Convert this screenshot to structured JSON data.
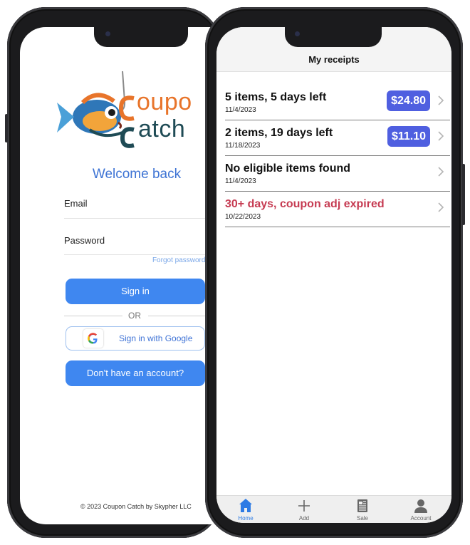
{
  "login": {
    "logo_line1": "oupo",
    "logo_line2": "atch",
    "welcome": "Welcome back",
    "email_label": "Email",
    "password_label": "Password",
    "forgot_password": "Forgot password?",
    "sign_in": "Sign in",
    "or": "OR",
    "google_sign_in": "Sign in with Google",
    "no_account": "Don't have an account?",
    "footer": "© 2023 Coupon Catch by Skypher LLC"
  },
  "receipts": {
    "title": "My receipts",
    "items": [
      {
        "title": "5 items, 5 days left",
        "date": "11/4/2023",
        "price": "$24.80",
        "expired": false
      },
      {
        "title": "2 items, 19 days left",
        "date": "11/18/2023",
        "price": "$11.10",
        "expired": false
      },
      {
        "title": "No eligible items found",
        "date": "11/4/2023",
        "price": null,
        "expired": false
      },
      {
        "title": "30+ days, coupon adj expired",
        "date": "10/22/2023",
        "price": null,
        "expired": true
      }
    ],
    "tabs": [
      {
        "label": "Home",
        "icon": "home-icon",
        "active": true
      },
      {
        "label": "Add",
        "icon": "plus-icon",
        "active": false
      },
      {
        "label": "Sale",
        "icon": "newspaper-icon",
        "active": false
      },
      {
        "label": "Account",
        "icon": "person-icon",
        "active": false
      }
    ]
  },
  "colors": {
    "accent_blue": "#3f87f0",
    "price_badge": "#4f5fe0",
    "expired_red": "#c63b52",
    "logo_orange": "#e8742a",
    "logo_teal": "#1f4b55"
  }
}
